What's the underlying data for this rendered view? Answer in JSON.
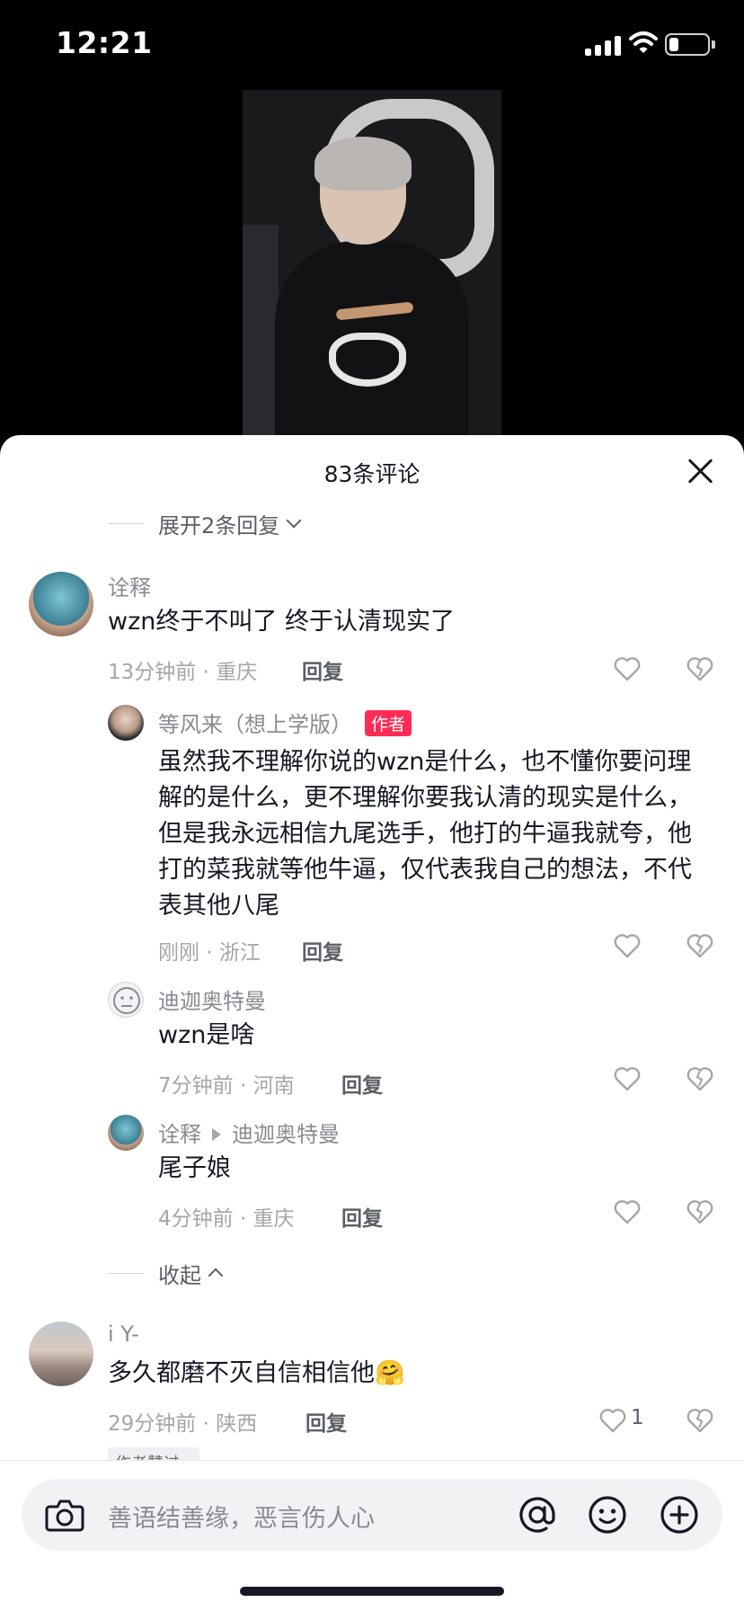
{
  "status_bar": {
    "time": "12:21"
  },
  "sheet": {
    "title": "83条评论",
    "expand_replies": "展开2条回复",
    "collapse": "收起",
    "reply_label": "回复"
  },
  "comments": [
    {
      "user": "诠释",
      "text": "wzn终于不叫了 终于认清现实了",
      "meta": "13分钟前 · 重庆",
      "replies": [
        {
          "user": "等风来（想上学版）",
          "badge": "作者",
          "text": "虽然我不理解你说的wzn是什么，也不懂你要问理解的是什么，更不理解你要我认清的现实是什么，但是我永远相信九尾选手，他打的牛逼我就夸，他打的菜我就等他牛逼，仅代表我自己的想法，不代表其他八尾",
          "meta": "刚刚 · 浙江"
        },
        {
          "user": "迪迦奥特曼",
          "text": "wzn是啥",
          "meta": "7分钟前 · 河南"
        },
        {
          "user": "诠释",
          "reply_to": "迪迦奥特曼",
          "text": "尾子娘",
          "meta": "4分钟前 · 重庆"
        }
      ]
    },
    {
      "user": "i Y-",
      "text": "多久都磨不灭自信相信他🤗",
      "meta": "29分钟前 · 陕西",
      "likes": "1",
      "tag": "作者赞过"
    }
  ],
  "input": {
    "placeholder": "善语结善缘，恶言伤人心"
  },
  "colors": {
    "accent": "#fe2c55",
    "text": "#161823",
    "muted": "#a5a6ab"
  },
  "icons": [
    "camera-icon",
    "at-icon",
    "emoji-icon",
    "plus-icon",
    "heart-icon",
    "dislike-icon",
    "close-icon"
  ]
}
